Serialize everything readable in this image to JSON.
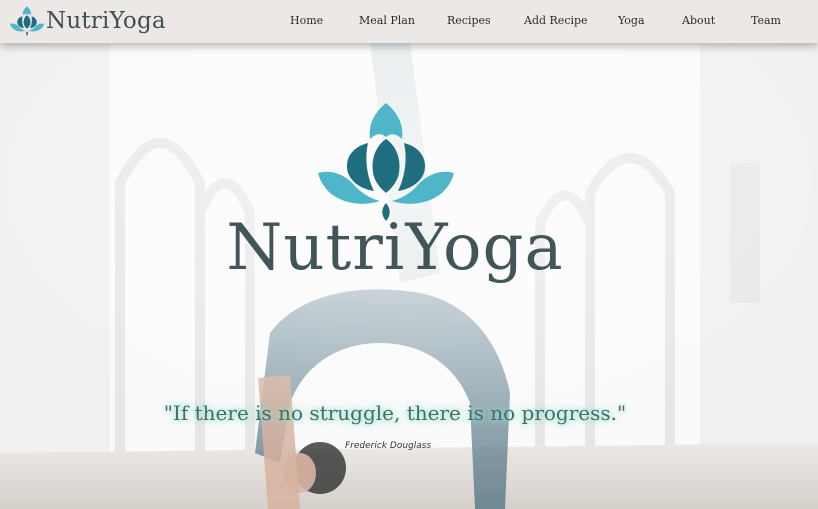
{
  "nav": {
    "brand": "NutriYoga",
    "links": [
      "Home",
      "Meal Plan",
      "Recipes",
      "Add Recipe",
      "Yoga",
      "About",
      "Team"
    ]
  },
  "hero": {
    "title": "NutriYoga",
    "quote": "\"If there is no struggle, there is no progress.\"",
    "author": "Frederick Douglass"
  },
  "colors": {
    "nav_bg": "#ece8e6",
    "brand_text": "#3f4f52",
    "lotus_light": "#4fb6c9",
    "lotus_dark": "#1f6e80",
    "quote_glow": "#8ce6d7"
  },
  "icons": [
    "lotus-icon"
  ]
}
